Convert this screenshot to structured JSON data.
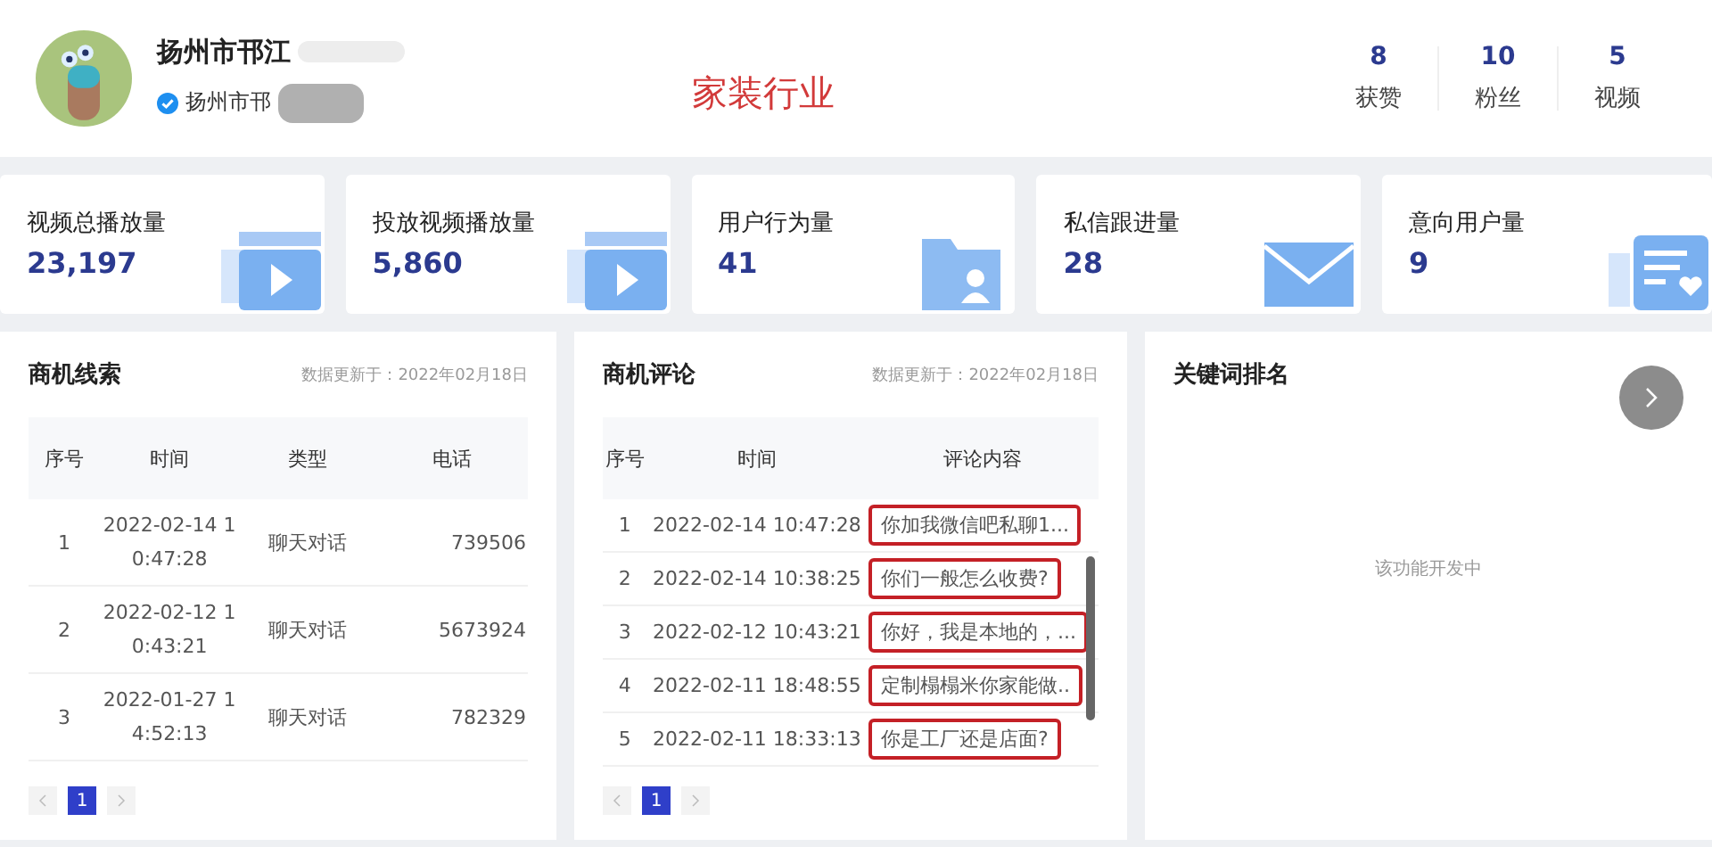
{
  "profile": {
    "name": "扬州市邗江",
    "subtitle": "扬州市邗",
    "verified": true,
    "industry": "家装行业",
    "stats": [
      {
        "value": "8",
        "label": "获赞"
      },
      {
        "value": "10",
        "label": "粉丝"
      },
      {
        "value": "5",
        "label": "视频"
      }
    ]
  },
  "metrics": [
    {
      "label": "视频总播放量",
      "value": "23,197",
      "kind": "video"
    },
    {
      "label": "投放视频播放量",
      "value": "5,860",
      "kind": "video"
    },
    {
      "label": "用户行为量",
      "value": "41",
      "kind": "folder"
    },
    {
      "label": "私信跟进量",
      "value": "28",
      "kind": "mail"
    },
    {
      "label": "意向用户量",
      "value": "9",
      "kind": "list"
    }
  ],
  "leads": {
    "title": "商机线索",
    "updated": "数据更新于：2022年02月18日",
    "columns": [
      "序号",
      "时间",
      "类型",
      "电话"
    ],
    "rows": [
      [
        "1",
        "2022-02-14 10:47:28",
        "聊天对话",
        "739506"
      ],
      [
        "2",
        "2022-02-12 10:43:21",
        "聊天对话",
        "5673924"
      ],
      [
        "3",
        "2022-01-27 14:52:13",
        "聊天对话",
        "782329"
      ]
    ],
    "pages": [
      {
        "label": "1",
        "selected": true
      }
    ]
  },
  "comments": {
    "title": "商机评论",
    "updated": "数据更新于：2022年02月18日",
    "columns": [
      "序号",
      "时间",
      "评论内容"
    ],
    "rows": [
      {
        "cells": [
          "1",
          "2022-02-14 10:47:28",
          "你加我微信吧私聊1..."
        ],
        "highlighted": true
      },
      {
        "cells": [
          "2",
          "2022-02-14 10:38:25",
          "你们一般怎么收费?"
        ],
        "highlighted": true
      },
      {
        "cells": [
          "3",
          "2022-02-12 10:43:21",
          "你好，我是本地的，..."
        ],
        "highlighted": true
      },
      {
        "cells": [
          "4",
          "2022-02-11 18:48:55",
          "定制榻榻米你家能做.."
        ],
        "highlighted": true
      },
      {
        "cells": [
          "5",
          "2022-02-11 18:33:13",
          "你是工厂还是店面?"
        ],
        "highlighted": true
      }
    ],
    "pages": [
      {
        "label": "1",
        "selected": true
      }
    ]
  },
  "keywords": {
    "title": "关键词排名",
    "empty_text": "该功能开发中"
  }
}
